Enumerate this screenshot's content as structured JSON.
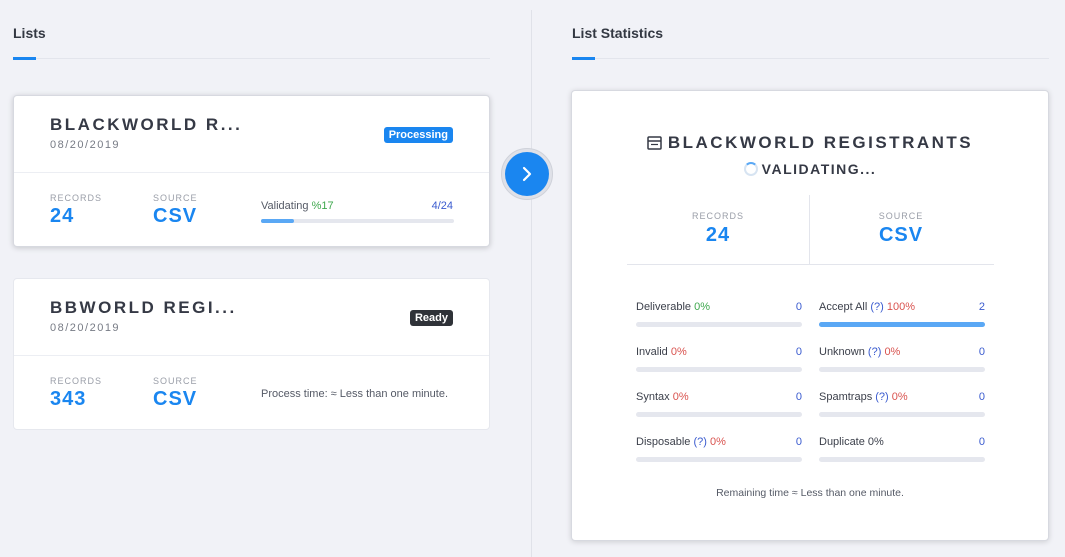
{
  "left_panel": {
    "title": "Lists"
  },
  "right_panel": {
    "title": "List Statistics"
  },
  "lists": [
    {
      "name": "BLACKWORLD R...",
      "date": "08/20/2019",
      "status": "Processing",
      "records_label": "RECORDS",
      "records": "24",
      "source_label": "SOURCE",
      "source": "CSV",
      "progress_label": "Validating",
      "progress_pct": "%17",
      "progress_count": "4/24",
      "progress_fraction": 0.17
    },
    {
      "name": "BBWORLD REGI...",
      "date": "08/20/2019",
      "status": "Ready",
      "records_label": "RECORDS",
      "records": "343",
      "source_label": "SOURCE",
      "source": "CSV",
      "process_time": "Process time: ≈ Less than one minute."
    }
  ],
  "stats": {
    "title": "BLACKWORLD REGISTRANTS",
    "status": "VALIDATING...",
    "records_label": "RECORDS",
    "records": "24",
    "source_label": "SOURCE",
    "source": "CSV",
    "metrics": [
      {
        "label": "Deliverable",
        "help": "",
        "pct": "0%",
        "count": "0",
        "fraction": 0
      },
      {
        "label": "Accept All",
        "help": "(?)",
        "pct": "100%",
        "count": "2",
        "fraction": 1
      },
      {
        "label": "Invalid",
        "help": "",
        "pct": "0%",
        "count": "0",
        "fraction": 0
      },
      {
        "label": "Unknown",
        "help": "(?)",
        "pct": "0%",
        "count": "0",
        "fraction": 0
      },
      {
        "label": "Syntax",
        "help": "",
        "pct": "0%",
        "count": "0",
        "fraction": 0
      },
      {
        "label": "Spamtraps",
        "help": "(?)",
        "pct": "0%",
        "count": "0",
        "fraction": 0
      },
      {
        "label": "Disposable",
        "help": "(?)",
        "pct": "0%",
        "count": "0",
        "fraction": 0
      },
      {
        "label": "Duplicate",
        "help": "",
        "pct": "0%",
        "count": "0",
        "fraction": 0
      }
    ],
    "remaining": "Remaining time ≈ Less than one minute."
  },
  "colors": {
    "accent": "#1a86f0",
    "progress": "#5aa8f5",
    "ready_badge": "#2f3238",
    "danger": "#d9534f",
    "success": "#3fa84e"
  }
}
